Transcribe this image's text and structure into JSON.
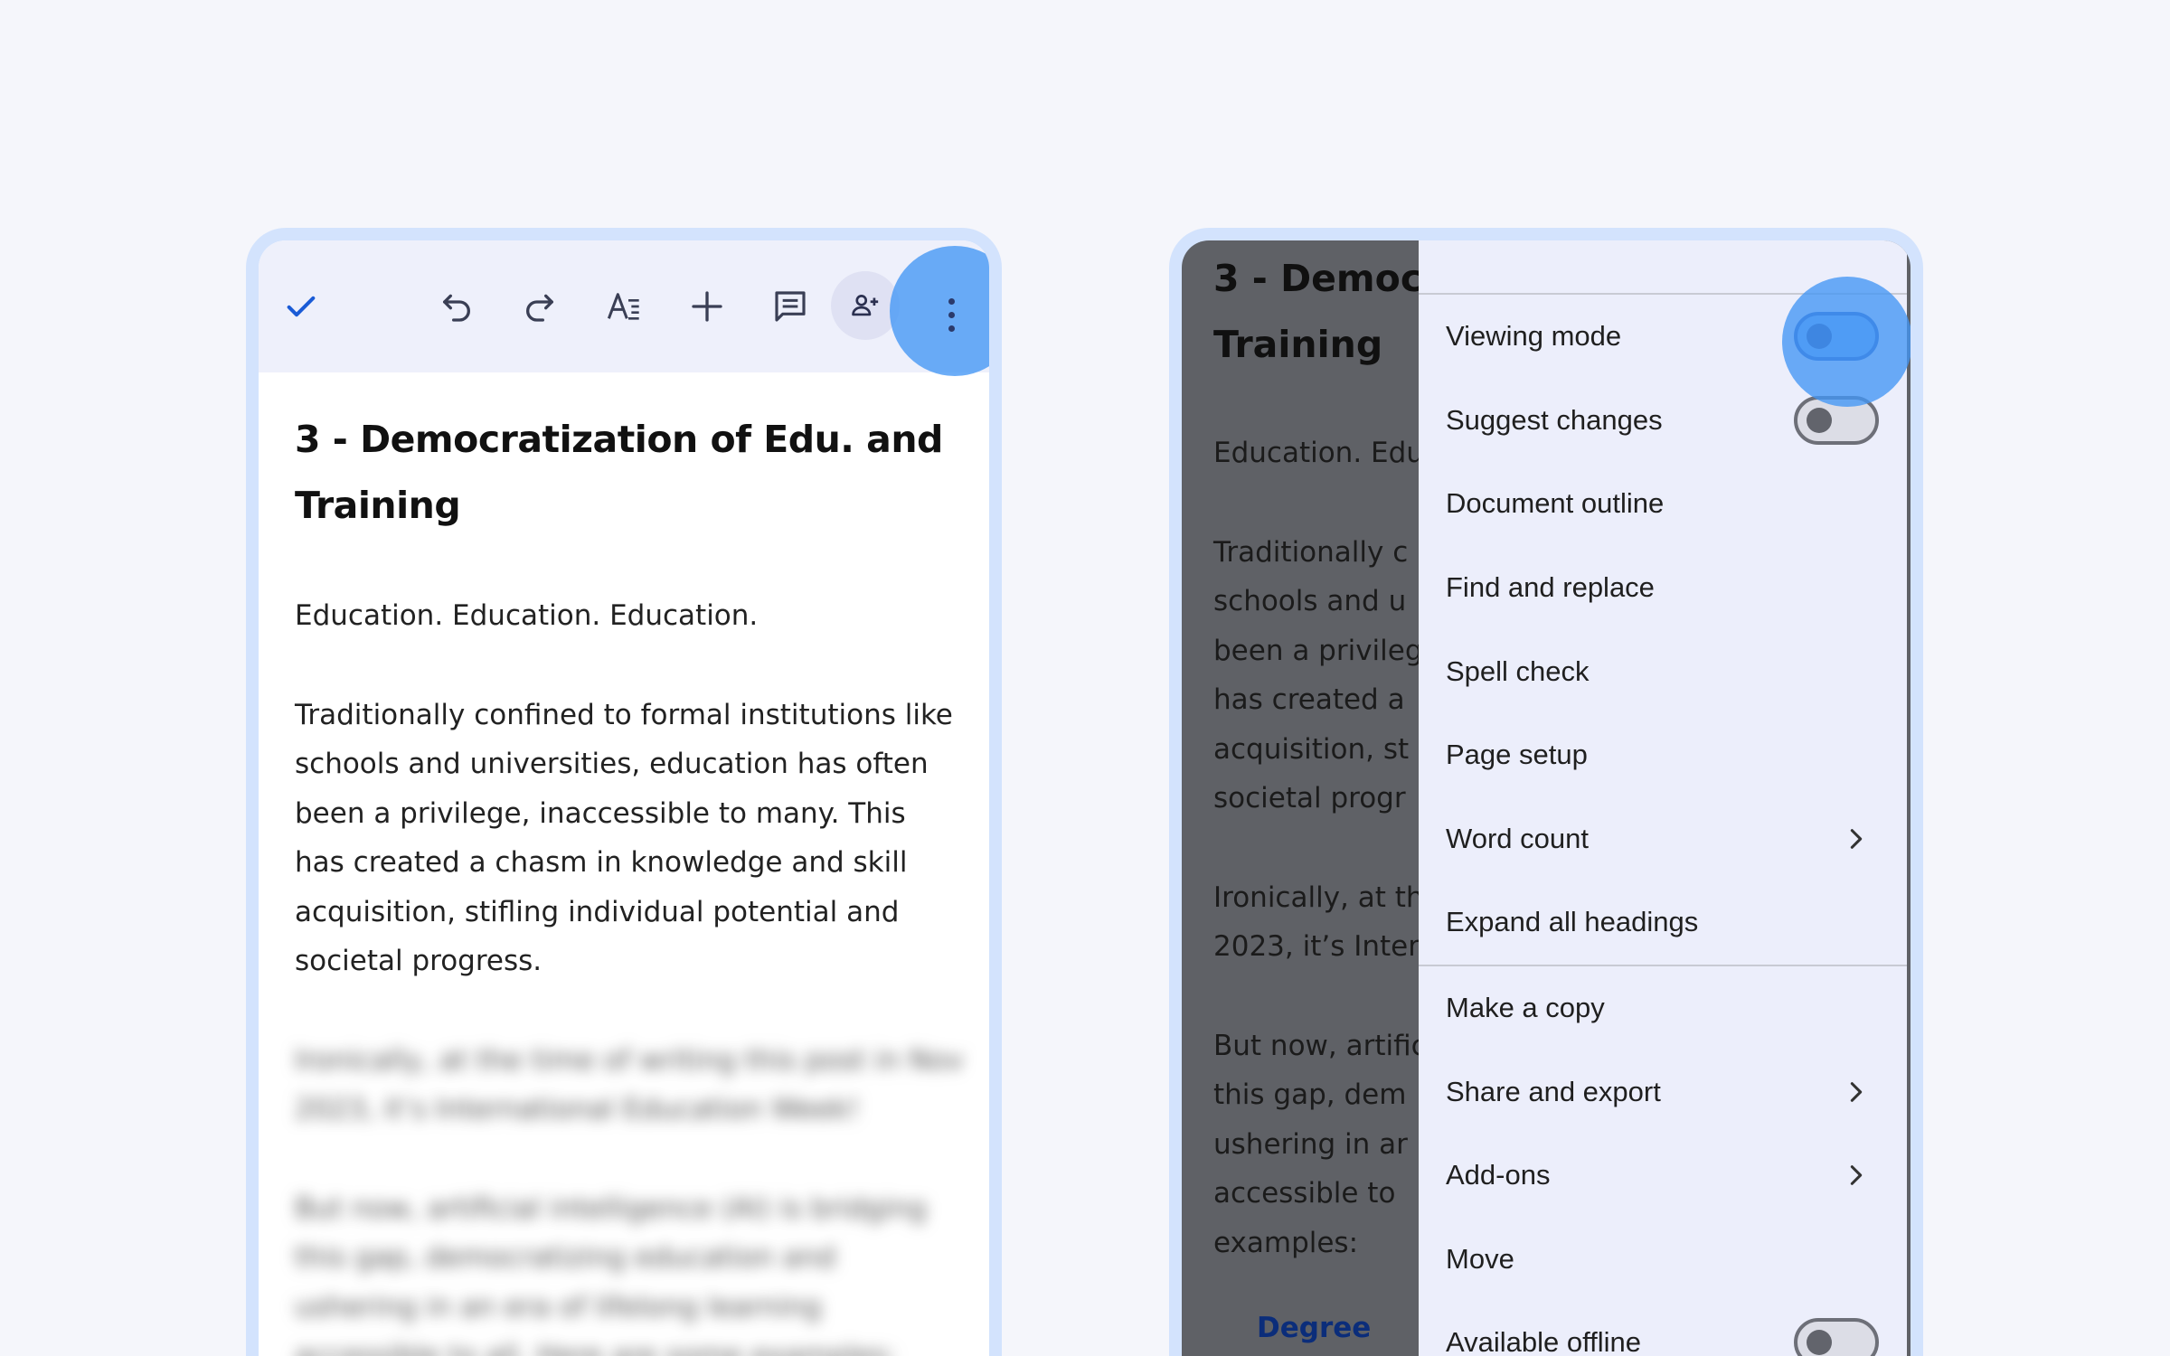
{
  "left_phone": {
    "toolbar": {
      "done_icon": "check-icon",
      "undo_icon": "undo-icon",
      "redo_icon": "redo-icon",
      "format_icon": "text-format-icon",
      "insert_icon": "plus-icon",
      "comment_icon": "comment-icon",
      "share_icon": "person-add-icon",
      "more_icon": "more-vert-icon",
      "accent_color": "#1a5bd6"
    },
    "document": {
      "title_line1": "3 - Democratization of Edu. and",
      "title_line2": "Training",
      "subtitle": "Education. Education. Education.",
      "paragraph1": [
        "Traditionally confined to formal institutions like",
        "schools and universities, education has often",
        "been a privilege, inaccessible to many. This",
        "has created a chasm in knowledge and skill",
        "acquisition, stifling individual potential and",
        "societal progress."
      ],
      "paragraph2_blurred": [
        "Ironically, at the time of writing this post in Nov",
        "2023, it’s International Education Week!"
      ],
      "paragraph3_blurred": [
        "But now, artificial intelligence (AI) is bridging",
        "this gap, democratizing education and",
        "ushering in an era of lifelong learning",
        "accessible to all. Here are some examples:"
      ]
    }
  },
  "right_phone": {
    "dimmed_document": {
      "title_line1": "3 - Democ",
      "title_line2": "Training",
      "subtitle": "Education. Edu",
      "paragraph1": [
        "Traditionally c",
        "schools and u",
        "been a privileg",
        "has created a",
        "acquisition, st",
        "societal progr"
      ],
      "paragraph2": [
        "Ironically, at th",
        "2023, it’s Intern"
      ],
      "paragraph3": [
        "But now, artific",
        "this gap, dem",
        "ushering in ar",
        "accessible to",
        "examples:"
      ],
      "bullet_link": "Degree"
    },
    "menu": {
      "items": [
        {
          "label": "Viewing mode",
          "control": "toggle",
          "state": "on"
        },
        {
          "label": "Suggest changes",
          "control": "toggle",
          "state": "off"
        },
        {
          "label": "Document outline"
        },
        {
          "label": "Find and replace"
        },
        {
          "label": "Spell check"
        },
        {
          "label": "Page setup"
        },
        {
          "label": "Word count",
          "control": "chevron-right-icon"
        },
        {
          "label": "Expand all headings"
        },
        {
          "label": "Make a copy"
        },
        {
          "label": "Share and export",
          "control": "chevron-right-icon"
        },
        {
          "label": "Add-ons",
          "control": "chevron-right-icon"
        },
        {
          "label": "Move"
        },
        {
          "label": "Available offline",
          "control": "toggle",
          "state": "off"
        }
      ]
    }
  },
  "colors": {
    "background": "#f5f6fb",
    "frame": "#d3e3fd",
    "highlight": "#4296f5",
    "toolbar": "#eef0fb",
    "menu": "#eceefb",
    "scrim": "#5f6166"
  }
}
